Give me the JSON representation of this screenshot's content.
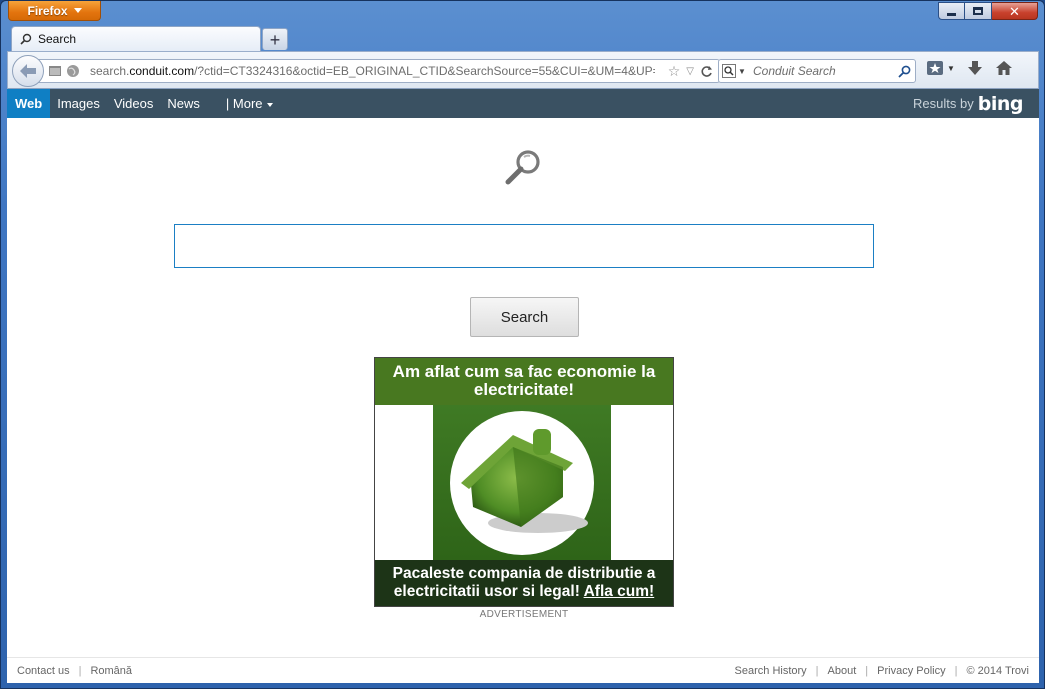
{
  "window": {
    "app_button_label": "Firefox"
  },
  "tab": {
    "title": "Search"
  },
  "navbar": {
    "url_prefix": "search.",
    "url_domain": "conduit.com",
    "url_rest": "/?ctid=CT3324316&octid=EB_ORIGINAL_CTID&SearchSource=55&CUI=&UM=4&UP=",
    "search_placeholder": "Conduit Search"
  },
  "topnav": {
    "items": [
      "Web",
      "Images",
      "Videos",
      "News"
    ],
    "more_label": "| More",
    "results_by": "Results by",
    "bing": "bing"
  },
  "search": {
    "query": "",
    "button_label": "Search"
  },
  "ad": {
    "headline": "Am aflat cum sa fac economie la electricitate!",
    "body": "Pacaleste compania de distributie a electricitatii usor si legal!",
    "cta": "Afla cum!",
    "label": "ADVERTISEMENT"
  },
  "footer": {
    "left": [
      "Contact us",
      "Română"
    ],
    "right": [
      "Search History",
      "About",
      "Privacy Policy",
      "© 2014 Trovi"
    ]
  },
  "colors": {
    "nav_bg": "#3a5162",
    "nav_active": "#0f7fc4",
    "ad_green": "#487820",
    "ad_dark": "#1d3417"
  }
}
